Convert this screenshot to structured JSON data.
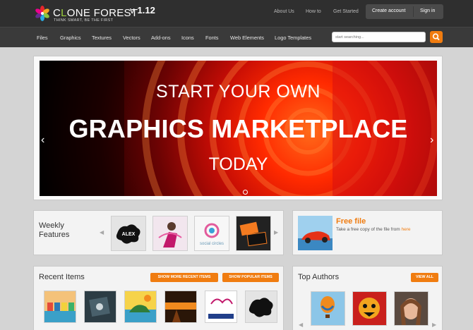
{
  "header": {
    "logo_text_c": "C",
    "logo_text_o": "L",
    "logo_text_rest": "ONE FOREST",
    "tagline": "THINK SMART, BE THE FIRST",
    "version_prefix": "v",
    "version_number": "1.12",
    "links": [
      "About Us",
      "How to",
      "Get Started"
    ],
    "create_account": "Create account",
    "sign_in": "Sign in"
  },
  "nav": {
    "items": [
      "Files",
      "Graphics",
      "Textures",
      "Vectors",
      "Add-ons",
      "Icons",
      "Fonts",
      "Web Elements",
      "Logo Templates"
    ],
    "search_placeholder": "start searching..."
  },
  "hero": {
    "line1": "START YOUR OWN",
    "line2": "GRAPHICS MARKETPLACE",
    "line3": "TODAY"
  },
  "weekly": {
    "title_line1": "Weekly",
    "title_line2": "Features",
    "thumb_labels": [
      "ALEX",
      "social circles"
    ]
  },
  "free_file": {
    "title": "Free file",
    "desc": "Take a free copy of the file from",
    "link": "here"
  },
  "recent": {
    "title": "Recent Items",
    "btn_more": "SHOW MORE RECENT ITEMS",
    "btn_popular": "SHOW POPULAR ITEMS"
  },
  "authors": {
    "title": "Top Authors",
    "btn_all": "VIEW ALL"
  },
  "colors": {
    "accent": "#f07c10",
    "topbar": "#2f2f2f",
    "nav": "#3a3a3a",
    "background": "#d4d4d4"
  }
}
